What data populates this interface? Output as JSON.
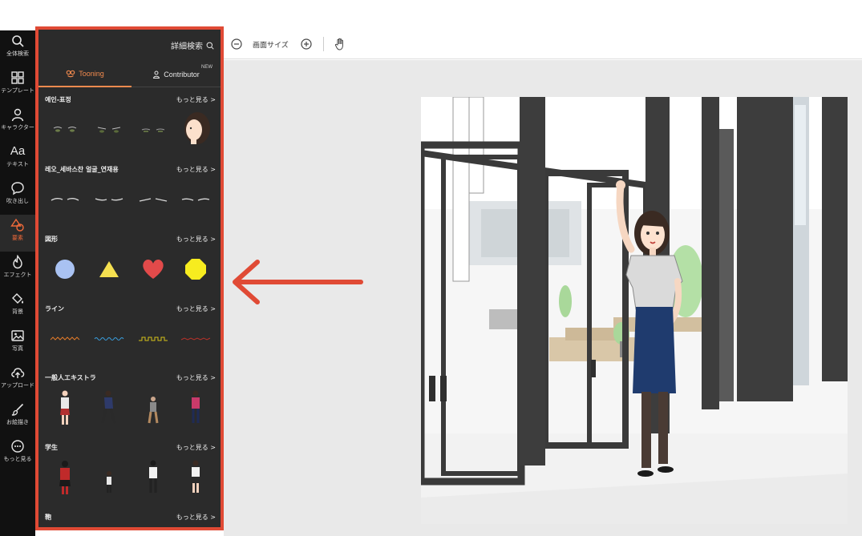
{
  "rail": {
    "items": [
      {
        "label": "全体検索",
        "icon": "search-icon"
      },
      {
        "label": "テンプレート",
        "icon": "grid-icon"
      },
      {
        "label": "キャラクター",
        "icon": "person-icon"
      },
      {
        "label": "テキスト",
        "icon": "text-icon",
        "glyph": "Aa"
      },
      {
        "label": "吹き出し",
        "icon": "speech-bubble-icon"
      },
      {
        "label": "要素",
        "icon": "shapes-icon",
        "active": true
      },
      {
        "label": "エフェクト",
        "icon": "flame-icon"
      },
      {
        "label": "背景",
        "icon": "paint-bucket-icon"
      },
      {
        "label": "写真",
        "icon": "photo-icon"
      },
      {
        "label": "アップロード",
        "icon": "cloud-upload-icon"
      },
      {
        "label": "お絵描き",
        "icon": "brush-icon"
      },
      {
        "label": "もっと見る",
        "icon": "more-icon"
      }
    ]
  },
  "panel": {
    "advanced_search": "詳細検索",
    "tabs": [
      {
        "label": "Tooning",
        "icon": "tooning-logo-icon",
        "active": true
      },
      {
        "label": "Contributor",
        "icon": "person-outline-icon",
        "badge": "NEW"
      }
    ],
    "sections": [
      {
        "title": "예인-표정",
        "more": "もっと見る >"
      },
      {
        "title": "레오_세바스찬 얼굴_연재용",
        "more": "もっと見る >"
      },
      {
        "title": "図形",
        "more": "もっと見る >"
      },
      {
        "title": "ライン",
        "more": "もっと見る >"
      },
      {
        "title": "一般人エキストラ",
        "more": "もっと見る >"
      },
      {
        "title": "学生",
        "more": "もっと見る >"
      },
      {
        "title": "鞄",
        "more": "もっと見る >"
      }
    ]
  },
  "toolbar": {
    "canvas_size_label": "画面サイズ"
  },
  "colors": {
    "accent": "#f28a4e",
    "highlight_border": "#e04a35",
    "panel_bg": "#2b2b2b",
    "rail_bg": "#111111",
    "shape_circle": "#a9c2f2",
    "shape_triangle": "#f5e050",
    "shape_heart": "#e24a4a",
    "shape_octagon": "#f7ec1f",
    "arrow": "#e04a35"
  }
}
